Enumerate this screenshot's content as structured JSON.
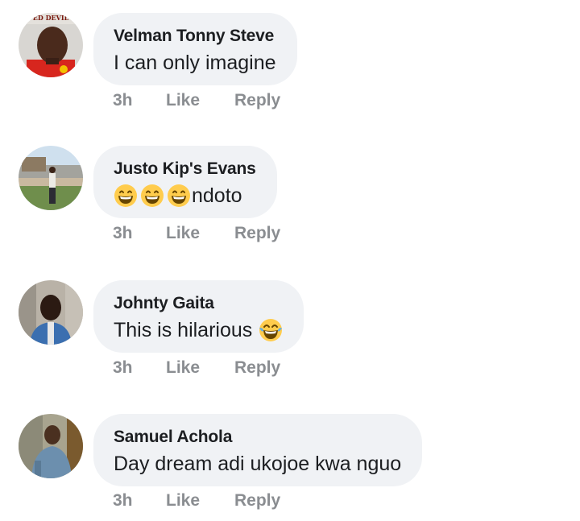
{
  "comments": [
    {
      "author": "Velman Tonny Steve",
      "text": "I can only imagine",
      "time": "3h",
      "like_label": "Like",
      "reply_label": "Reply",
      "avatar_badge_text": "ED DEVIL"
    },
    {
      "author": "Justo Kip's Evans",
      "text": "ndoto",
      "emoji_prefix": [
        "grinning-face-with-smiling-eyes",
        "grinning-face-with-smiling-eyes",
        "grinning-face-with-smiling-eyes"
      ],
      "time": "3h",
      "like_label": "Like",
      "reply_label": "Reply"
    },
    {
      "author": "Johnty Gaita",
      "text": "This is hilarious",
      "emoji_suffix": "face-with-tears-of-joy",
      "time": "3h",
      "like_label": "Like",
      "reply_label": "Reply"
    },
    {
      "author": "Samuel Achola",
      "text": "Day dream adi ukojoe kwa nguo",
      "time": "3h",
      "like_label": "Like",
      "reply_label": "Reply"
    }
  ],
  "colors": {
    "bubble_bg": "#f0f2f5",
    "text": "#1c1e21",
    "meta": "#8a8d91",
    "emoji_yellow": "#ffcc4d"
  }
}
